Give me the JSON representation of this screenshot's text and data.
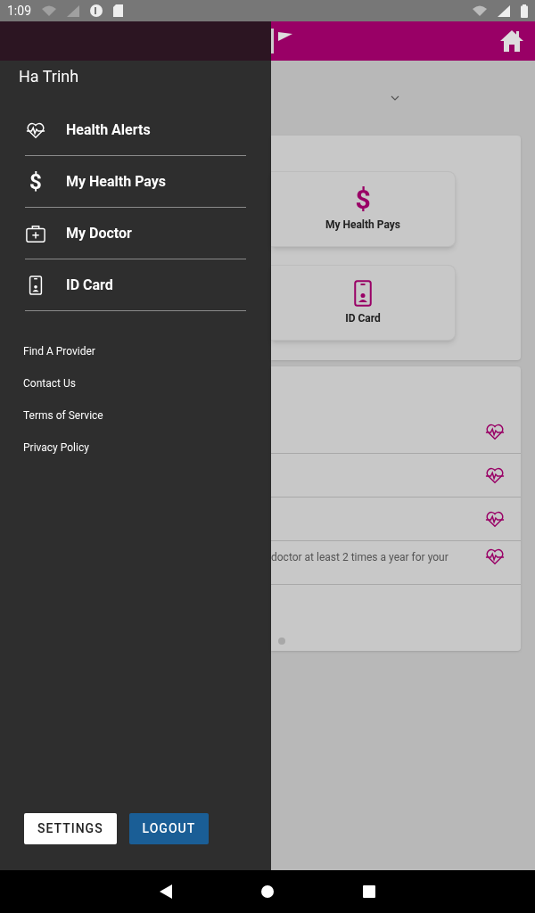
{
  "status_bar": {
    "time": "1:09"
  },
  "drawer": {
    "user_name": "Ha Trinh",
    "menu": [
      {
        "label": "Health Alerts"
      },
      {
        "label": "My Health Pays",
        "symbol": "$"
      },
      {
        "label": "My Doctor"
      },
      {
        "label": "ID Card"
      }
    ],
    "links": [
      "Find A Provider",
      "Contact Us",
      "Terms of Service",
      "Privacy Policy"
    ],
    "buttons": [
      {
        "label": "SETTINGS",
        "kind": "secondary"
      },
      {
        "label": "LOGOUT",
        "kind": "primary"
      }
    ]
  },
  "dashboard": {
    "tiles": [
      {
        "label": "My Health Pays",
        "symbol": "$"
      },
      {
        "label": "ID Card"
      }
    ],
    "alerts": [
      {
        "kind": "covered"
      },
      {
        "kind": "covered"
      },
      {
        "kind": "covered"
      },
      {
        "kind": "partial",
        "text": "doctor at least 2 times a year for your"
      }
    ]
  }
}
